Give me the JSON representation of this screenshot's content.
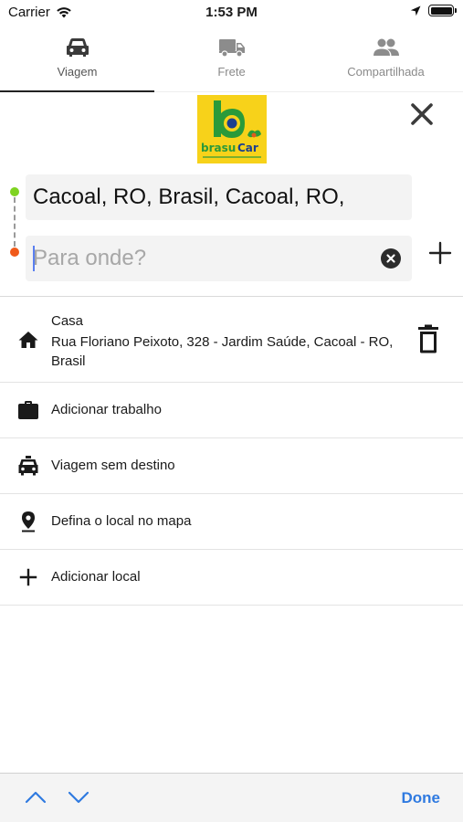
{
  "status_bar": {
    "carrier": "Carrier",
    "time": "1:53 PM"
  },
  "tabs": [
    {
      "label": "Viagem",
      "icon": "car-icon",
      "active": true
    },
    {
      "label": "Frete",
      "icon": "truck-icon",
      "active": false
    },
    {
      "label": "Compartilhada",
      "icon": "group-icon",
      "active": false
    }
  ],
  "logo": {
    "text": "brasuCar"
  },
  "route": {
    "origin": "Cacoal, RO, Brasil, Cacoal, RO,",
    "destination_placeholder": "Para onde?",
    "destination_value": ""
  },
  "saved_places": {
    "home": {
      "name": "Casa",
      "address": "Rua Floriano Peixoto, 328 - Jardim Saúde, Cacoal - RO, Brasil"
    },
    "items": [
      {
        "label": "Adicionar trabalho",
        "icon": "briefcase-icon"
      },
      {
        "label": "Viagem sem destino",
        "icon": "taxi-icon"
      },
      {
        "label": "Defina o local no mapa",
        "icon": "map-pin-icon"
      },
      {
        "label": "Adicionar local",
        "icon": "plus-icon"
      }
    ]
  },
  "keyboard_toolbar": {
    "done_label": "Done"
  },
  "colors": {
    "origin_dot": "#7ed321",
    "destination_dot": "#f05a1a",
    "done": "#2f7ae0",
    "logo_yellow": "#f7d21a",
    "logo_green": "#2a9a3a",
    "logo_blue": "#1c3f8f"
  }
}
